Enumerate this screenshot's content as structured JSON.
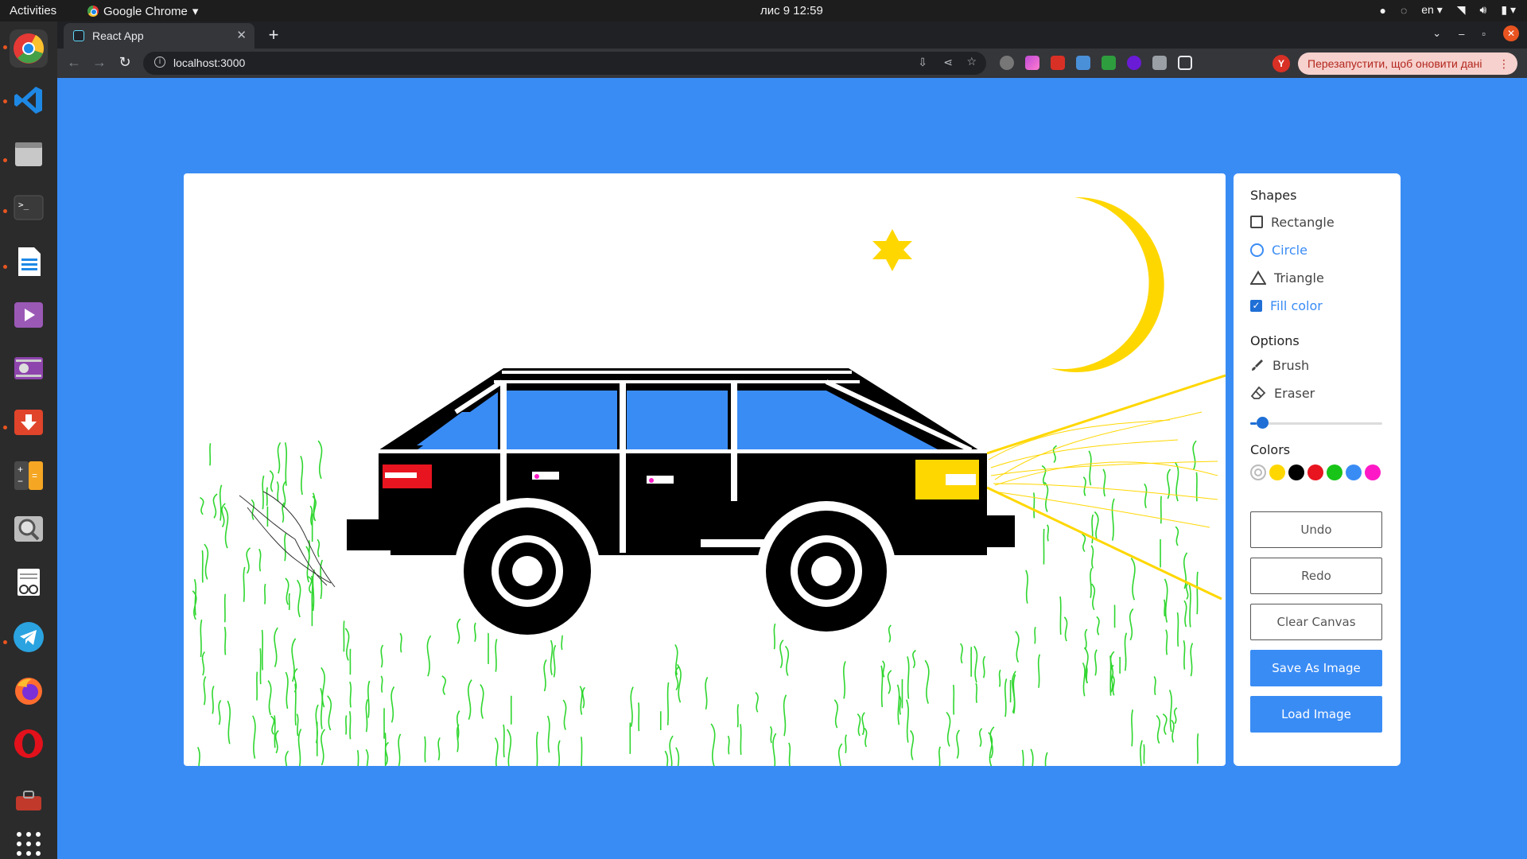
{
  "system": {
    "activities": "Activities",
    "app_name": "Google Chrome",
    "clock": "лис 9  12:59",
    "lang": "en"
  },
  "browser": {
    "tab_title": "React App",
    "url": "localhost:3000",
    "relaunch_label": "Перезапустити, щоб оновити дані",
    "profile_initial": "Y"
  },
  "panel": {
    "shapes_title": "Shapes",
    "shapes": [
      {
        "label": "Rectangle",
        "active": false
      },
      {
        "label": "Circle",
        "active": true
      },
      {
        "label": "Triangle",
        "active": false
      }
    ],
    "fill_label": "Fill color",
    "fill_checked": true,
    "options_title": "Options",
    "options": [
      {
        "label": "Brush"
      },
      {
        "label": "Eraser"
      }
    ],
    "brush_size_fraction": 0.05,
    "colors_title": "Colors",
    "colors": [
      "#ffffff",
      "#ffd700",
      "#000000",
      "#e8141f",
      "#18c418",
      "#3a8cf5",
      "#ff19c6"
    ],
    "selected_color": "#ffffff",
    "buttons": {
      "undo": "Undo",
      "redo": "Redo",
      "clear": "Clear Canvas",
      "save": "Save As Image",
      "load": "Load Image"
    }
  },
  "colors": {
    "page_bg": "#3a8cf5",
    "accent": "#1f6fd6"
  }
}
